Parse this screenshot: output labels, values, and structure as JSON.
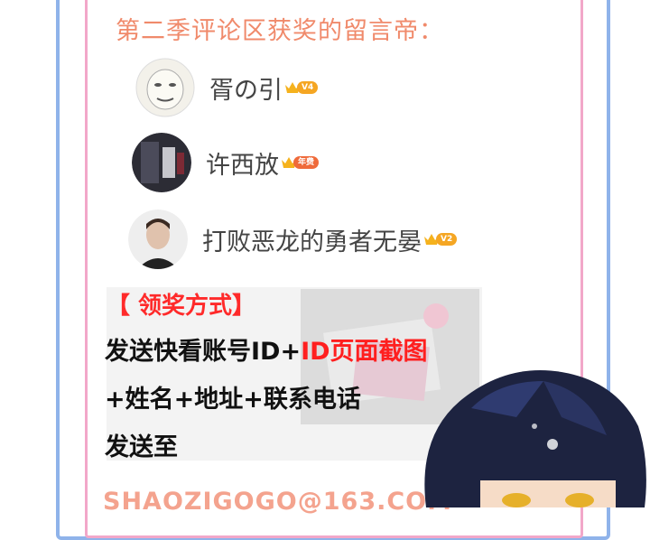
{
  "title": "第二季评论区获奖的留言帝：",
  "winners": [
    {
      "name": "胥の引",
      "badge": "V4"
    },
    {
      "name": "许西放",
      "badge": "年费"
    },
    {
      "name": "打败恶龙的勇者无晏",
      "badge": "V2"
    }
  ],
  "method_title": "【 领奖方式】",
  "lines": {
    "line1_a": "发送快看账号ID+",
    "line1_b": "ID页面截图",
    "line2": "+姓名+地址+联系电话",
    "line3": "发送至"
  },
  "email": "SHAOZIGOGO@163.COM",
  "colors": {
    "title": "#f08a6b",
    "accent_red": "#ff1f1f",
    "badge": "#f5a623"
  }
}
